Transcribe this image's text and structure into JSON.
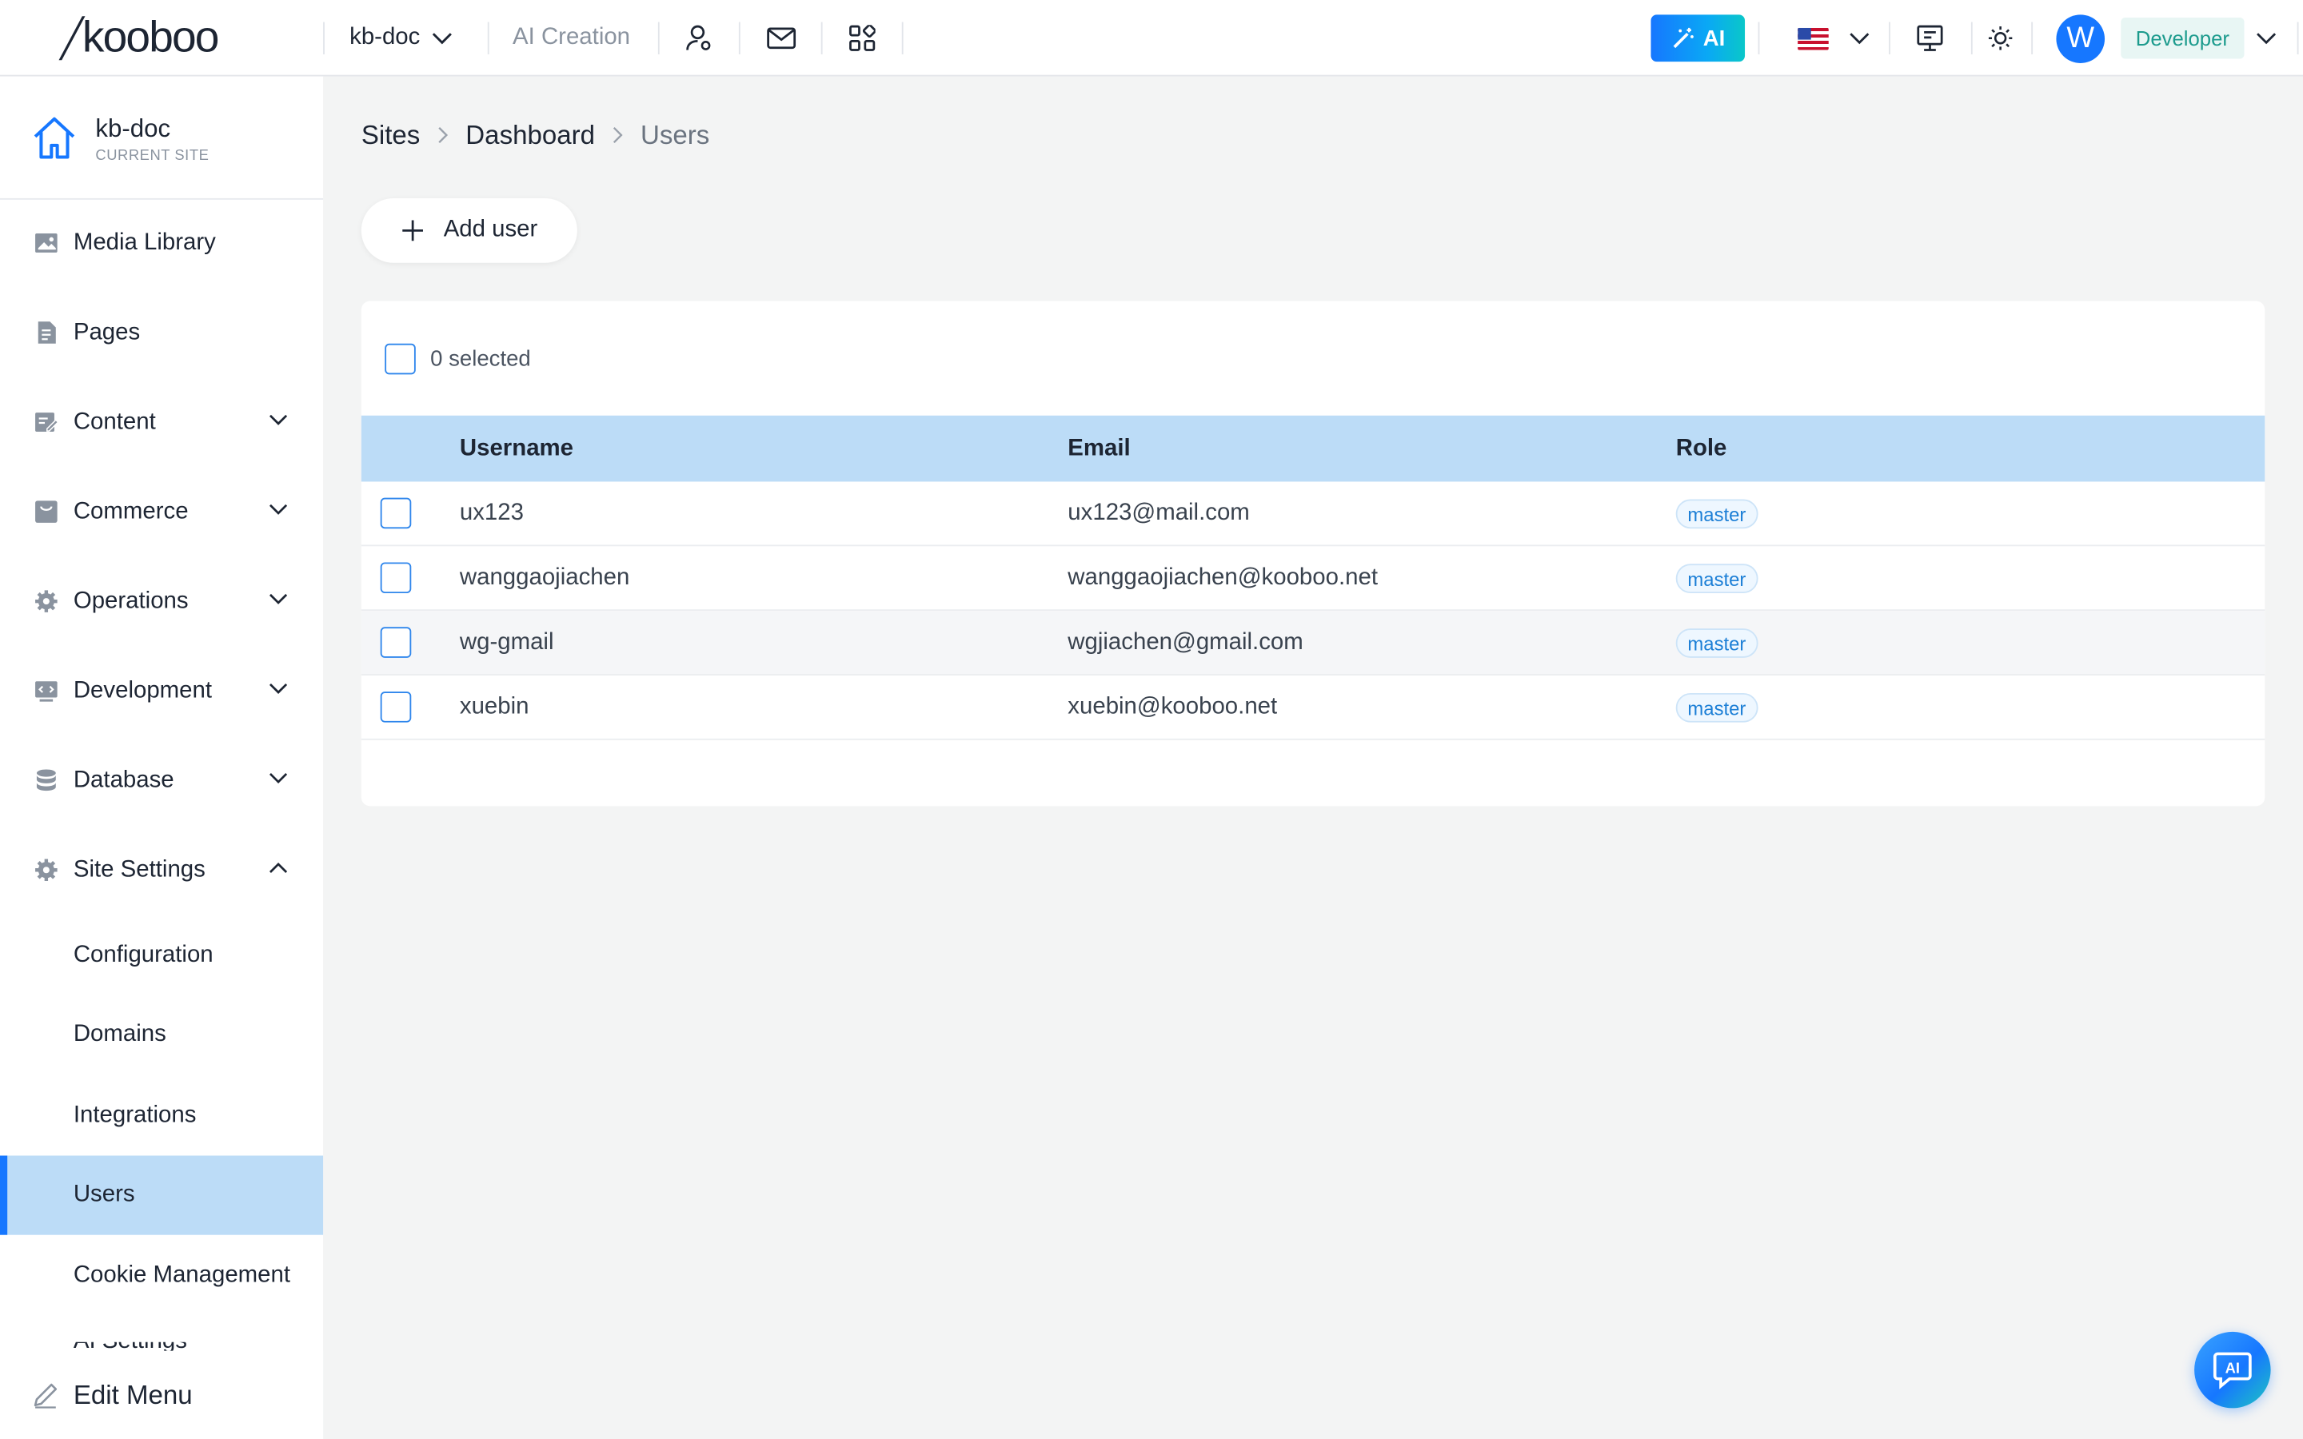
{
  "topbar": {
    "logo_text": "kooboo",
    "site_selector": "kb-doc",
    "ai_creation": "AI Creation",
    "ai_button": "AI",
    "avatar_letter": "W",
    "role": "Developer"
  },
  "sidebar": {
    "current_site_name": "kb-doc",
    "current_site_sub": "CURRENT SITE",
    "items": [
      {
        "label": "Media Library",
        "icon": "image-icon"
      },
      {
        "label": "Pages",
        "icon": "page-icon"
      },
      {
        "label": "Content",
        "icon": "content-icon"
      },
      {
        "label": "Commerce",
        "icon": "commerce-icon"
      },
      {
        "label": "Operations",
        "icon": "gear-icon"
      },
      {
        "label": "Development",
        "icon": "code-icon"
      },
      {
        "label": "Database",
        "icon": "database-icon"
      },
      {
        "label": "Site Settings",
        "icon": "gear-icon"
      }
    ],
    "sub_items": [
      {
        "label": "Configuration"
      },
      {
        "label": "Domains"
      },
      {
        "label": "Integrations"
      },
      {
        "label": "Users",
        "active": true
      },
      {
        "label": "Cookie Management"
      }
    ],
    "clipped_item": "AI Settings",
    "edit_menu": "Edit Menu"
  },
  "breadcrumb": [
    "Sites",
    "Dashboard",
    "Users"
  ],
  "add_user_label": "Add user",
  "selection_text": "0 selected",
  "table": {
    "columns": [
      "Username",
      "Email",
      "Role"
    ],
    "rows": [
      {
        "username": "ux123",
        "email": "ux123@mail.com",
        "role": "master"
      },
      {
        "username": "wanggaojiachen",
        "email": "wanggaojiachen@kooboo.net",
        "role": "master"
      },
      {
        "username": "wg-gmail",
        "email": "wgjiachen@gmail.com",
        "role": "master"
      },
      {
        "username": "xuebin",
        "email": "xuebin@kooboo.net",
        "role": "master"
      }
    ]
  },
  "fab_label": "AI",
  "colors": {
    "accent": "#1677ff",
    "active_row": "#bcdcf7",
    "tag_text": "#1c7fd6",
    "developer_chip": "#e8f6f4"
  }
}
